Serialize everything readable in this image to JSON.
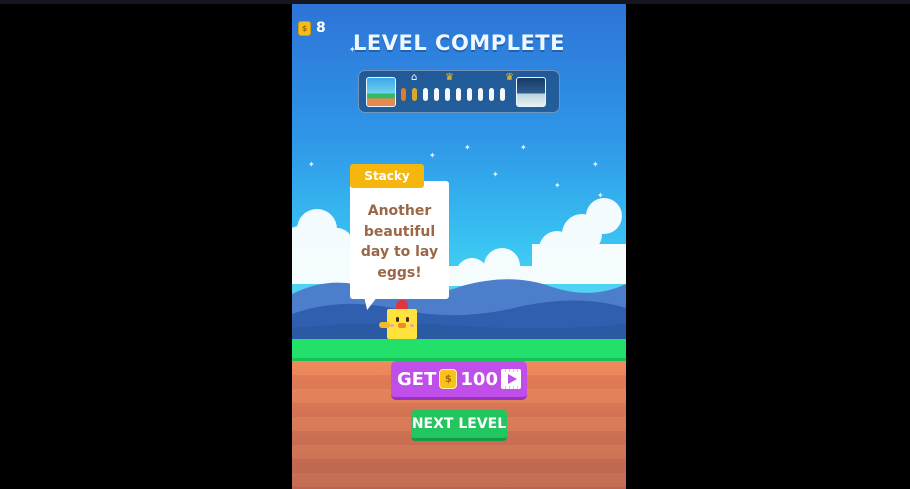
{
  "hud": {
    "coin_count": "8",
    "coin_symbol": "$"
  },
  "header": {
    "title": "LEVEL COMPLETE"
  },
  "progress": {
    "total_steps": 10,
    "completed_steps": 2,
    "markers": [
      "house-icon",
      "crown-icon",
      "crown-icon"
    ]
  },
  "speech": {
    "speaker": "Stacky",
    "lines": [
      "Another",
      "beautiful",
      "day to lay",
      "eggs!"
    ]
  },
  "buttons": {
    "get_label": "GET",
    "get_amount": "100",
    "coin_symbol": "$",
    "next_label": "NEXT LEVEL"
  },
  "colors": {
    "accent_purple": "#c04ee8",
    "accent_green": "#22c55e",
    "coin_gold": "#f3be1d",
    "name_tag": "#f5b70e"
  }
}
